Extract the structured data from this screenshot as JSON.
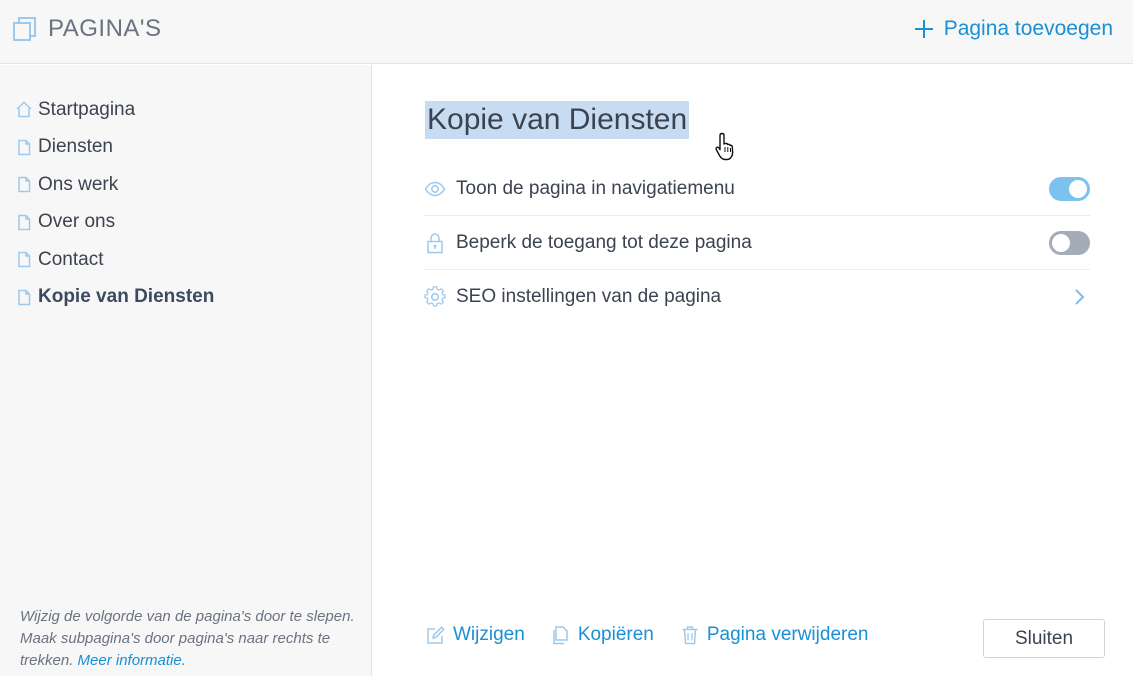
{
  "header": {
    "title": "PAGINA'S",
    "add_page_label": "Pagina toevoegen"
  },
  "sidebar": {
    "pages": [
      {
        "label": "Startpagina",
        "icon": "home-icon"
      },
      {
        "label": "Diensten",
        "icon": "page-icon"
      },
      {
        "label": "Ons werk",
        "icon": "page-icon"
      },
      {
        "label": "Over ons",
        "icon": "page-icon"
      },
      {
        "label": "Contact",
        "icon": "page-icon"
      },
      {
        "label": "Kopie van Diensten",
        "icon": "page-icon",
        "active": true
      }
    ],
    "note_text": "Wijzig de volgorde van de pagina's door te slepen. Maak subpagina's door pagina's naar rechts te trekken.",
    "note_link": "Meer informatie",
    "note_end": "."
  },
  "main": {
    "page_name": "Kopie van Diensten",
    "settings": [
      {
        "label": "Toon de pagina in navigatiemenu",
        "icon": "eye-icon",
        "control": "toggle",
        "on": true
      },
      {
        "label": "Beperk de toegang tot deze pagina",
        "icon": "lock-icon",
        "control": "toggle",
        "on": false
      },
      {
        "label": "SEO instellingen van de pagina",
        "icon": "gear-icon",
        "control": "chevron"
      }
    ],
    "actions": {
      "edit": "Wijzigen",
      "copy": "Kopiëren",
      "delete": "Pagina verwijderen"
    },
    "close_label": "Sluiten"
  },
  "colors": {
    "accent": "#1a8fd6",
    "toggle_on": "#7cc2ef",
    "toggle_off": "#a4acb9",
    "selection": "#c7dcf3"
  }
}
